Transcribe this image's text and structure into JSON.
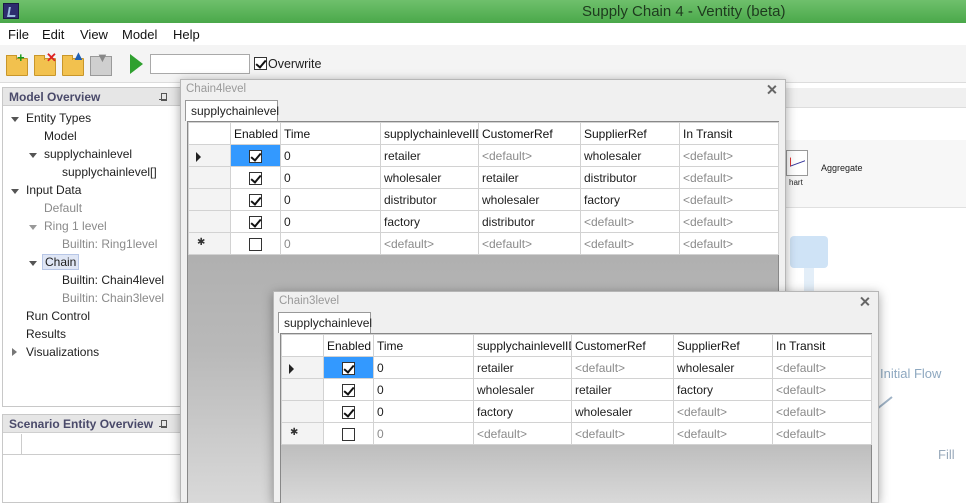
{
  "window": {
    "title": "Supply Chain 4 - Ventity (beta)"
  },
  "menu": [
    "File",
    "Edit",
    "View",
    "Model",
    "Help"
  ],
  "toolbar": {
    "run_input_value": "",
    "overwrite_label": "Overwrite",
    "overwrite_checked": true
  },
  "model_overview": {
    "title": "Model Overview",
    "items": [
      {
        "label": "Entity Types"
      },
      {
        "label": "Model"
      },
      {
        "label": "supplychainlevel"
      },
      {
        "label": "supplychainlevel[]"
      },
      {
        "label": "Input Data"
      },
      {
        "label": "Default"
      },
      {
        "label": "Ring 1 level"
      },
      {
        "label": "Builtin: Ring1level"
      },
      {
        "label": "Chain"
      },
      {
        "label": "Builtin: Chain4level"
      },
      {
        "label": "Builtin: Chain3level"
      },
      {
        "label": "Run Control"
      },
      {
        "label": "Results"
      },
      {
        "label": "Visualizations"
      }
    ]
  },
  "scenario_overview": {
    "title": "Scenario Entity Overview"
  },
  "background": {
    "aggregate": "Aggregate",
    "initial_flow": "Initial Flow",
    "fill_label": "Fill",
    "chart_label": "hart"
  },
  "chain4": {
    "title": "Chain4level",
    "tab": "supplychainlevel",
    "columns": [
      "Enabled",
      "Time",
      "supplychainlevelID",
      "CustomerRef",
      "SupplierRef",
      "In Transit"
    ],
    "rows": [
      {
        "enabled": true,
        "time": "0",
        "id": "retailer",
        "customer": "<default>",
        "supplier": "wholesaler",
        "transit": "<default>"
      },
      {
        "enabled": true,
        "time": "0",
        "id": "wholesaler",
        "customer": "retailer",
        "supplier": "distributor",
        "transit": "<default>"
      },
      {
        "enabled": true,
        "time": "0",
        "id": "distributor",
        "customer": "wholesaler",
        "supplier": "factory",
        "transit": "<default>"
      },
      {
        "enabled": true,
        "time": "0",
        "id": "factory",
        "customer": "distributor",
        "supplier": "<default>",
        "transit": "<default>"
      }
    ],
    "new_row": {
      "time": "0",
      "id": "<default>",
      "customer": "<default>",
      "supplier": "<default>",
      "transit": "<default>"
    }
  },
  "chain3": {
    "title": "Chain3level",
    "tab": "supplychainlevel",
    "columns": [
      "Enabled",
      "Time",
      "supplychainlevelID",
      "CustomerRef",
      "SupplierRef",
      "In Transit"
    ],
    "rows": [
      {
        "enabled": true,
        "time": "0",
        "id": "retailer",
        "customer": "<default>",
        "supplier": "wholesaler",
        "transit": "<default>"
      },
      {
        "enabled": true,
        "time": "0",
        "id": "wholesaler",
        "customer": "retailer",
        "supplier": "factory",
        "transit": "<default>"
      },
      {
        "enabled": true,
        "time": "0",
        "id": "factory",
        "customer": "wholesaler",
        "supplier": "<default>",
        "transit": "<default>"
      }
    ],
    "new_row": {
      "time": "0",
      "id": "<default>",
      "customer": "<default>",
      "supplier": "<default>",
      "transit": "<default>"
    }
  },
  "colors": {
    "titlebar": "#4aa84a",
    "selection": "#3399ff"
  }
}
